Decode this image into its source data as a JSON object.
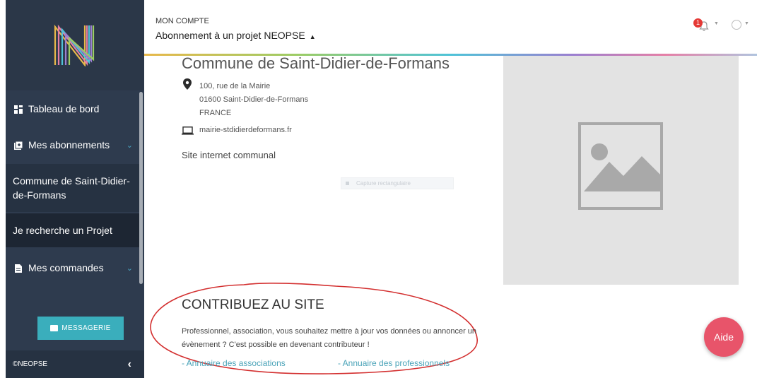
{
  "header": {
    "section_label": "MON COMPTE",
    "title": "Abonnement à un projet NEOPSE",
    "notification_count": "1"
  },
  "sidebar": {
    "items": [
      {
        "label": "Tableau de bord",
        "icon": "dashboard-icon"
      },
      {
        "label": "Mes abonnements",
        "icon": "subscriptions-icon"
      },
      {
        "label": "Commune de Saint-Didier-de-Formans"
      },
      {
        "label": "Je recherche un Projet"
      },
      {
        "label": "Mes commandes",
        "icon": "file-icon"
      }
    ],
    "messagerie_label": "MESSAGERIE",
    "footer": "©NEOPSE"
  },
  "commune": {
    "title": "Commune de Saint-Didier-de-Formans",
    "address_line1": "100, rue de la Mairie",
    "address_line2": "01600 Saint-Didier-de-Formans",
    "address_line3": "FRANCE",
    "website": "mairie-stdidierdeformans.fr",
    "site_link": "Site internet communal"
  },
  "capture_label": "Capture rectangulaire",
  "contribute": {
    "title": "CONTRIBUEZ AU SITE",
    "text": "Professionnel, association, vous souhaitez mettre à jour vos données ou annoncer un évènement ? C'est possible en devenant contributeur !",
    "link_associations": "- Annuaire des associations",
    "link_professionals": "- Annuaire des professionnels"
  },
  "aide_label": "Aide",
  "colors": {
    "sidebar_bg": "#2e3b4e",
    "accent": "#3aaebc",
    "aide_button": "#e8546a",
    "annotation": "#d32f2f"
  }
}
